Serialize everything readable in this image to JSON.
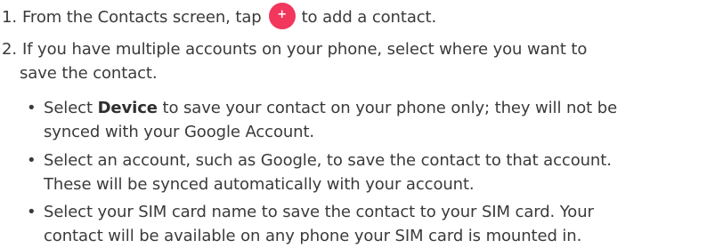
{
  "steps": [
    {
      "number": "1.",
      "before_icon": "From the Contacts screen, tap",
      "icon": "plus-icon",
      "icon_glyph": "+",
      "icon_color": "#f2365c",
      "after_icon": "to add a contact."
    },
    {
      "number": "2.",
      "line1": "If you have multiple accounts on your phone, select where you want to",
      "line2": "save the contact."
    }
  ],
  "bullets": [
    {
      "symbol": "•",
      "prefix": "Select",
      "bold": "Device",
      "line1_rest": "to save your contact on your phone only; they will not be",
      "line2": "synced with your Google Account."
    },
    {
      "symbol": "•",
      "line1": "Select an account, such as Google, to save the contact to that account.",
      "line2": "These will be synced automatically with your account."
    },
    {
      "symbol": "•",
      "line1": "Select your SIM card name to save the contact to your SIM card. Your",
      "line2": "contact will be available on any phone your SIM card is mounted in."
    }
  ]
}
